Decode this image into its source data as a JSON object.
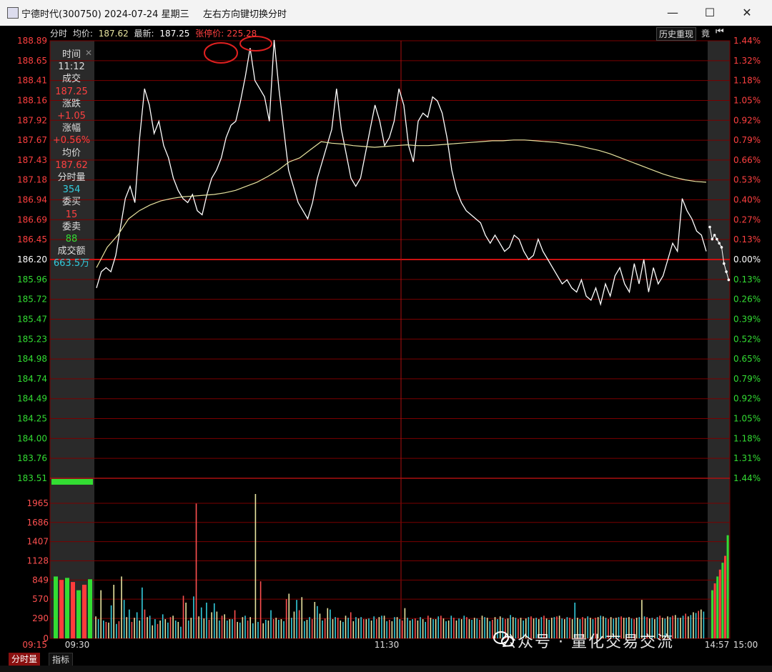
{
  "window": {
    "title": "宁德时代(300750) 2024-07-24 星期三",
    "hint": "左右方向键切换分时",
    "buttons": {
      "minimize": "—",
      "maximize": "☐",
      "close": "✕"
    }
  },
  "header": {
    "label_fenshi": "分时",
    "label_avg": "均价:",
    "avg_value": "187.62",
    "label_latest": "最新:",
    "latest_value": "187.25",
    "label_limit": "张停价:",
    "limit_value": "225.28",
    "history_replay": "历史重现",
    "auction_label": "竟"
  },
  "info_panel": {
    "time_label": "时间",
    "time_value": "11:12",
    "trade_label": "成交",
    "trade_value": "187.25",
    "change_label": "涨跌",
    "change_value": "+1.05",
    "pct_label": "涨幅",
    "pct_value": "+0.56%",
    "avg_label": "均价",
    "avg_value": "187.62",
    "vol_label": "分时量",
    "vol_value": "354",
    "bid_label": "委买",
    "bid_value": "15",
    "ask_label": "委卖",
    "ask_value": "88",
    "amount_label": "成交额",
    "amount_value": "663.5万"
  },
  "price_axis": [
    "188.89",
    "188.65",
    "188.41",
    "188.16",
    "187.92",
    "187.67",
    "187.43",
    "187.18",
    "186.94",
    "186.69",
    "186.45",
    "186.20",
    "185.96",
    "185.72",
    "185.47",
    "185.23",
    "184.98",
    "184.74",
    "184.49",
    "184.25",
    "184.00",
    "183.76",
    "183.51"
  ],
  "pct_axis": [
    "1.44%",
    "1.32%",
    "1.18%",
    "1.05%",
    "0.92%",
    "0.79%",
    "0.66%",
    "0.53%",
    "0.40%",
    "0.27%",
    "0.13%",
    "0.00%",
    "0.13%",
    "0.26%",
    "0.39%",
    "0.52%",
    "0.65%",
    "0.79%",
    "0.92%",
    "1.05%",
    "1.18%",
    "1.31%",
    "1.44%"
  ],
  "volume_axis": [
    "1965",
    "1686",
    "1407",
    "1128",
    "849",
    "570",
    "290",
    "0"
  ],
  "time_axis": [
    "09:15",
    "09:30",
    "11:30",
    "14:57",
    "15:00"
  ],
  "tabs": [
    "分时量",
    "指标"
  ],
  "watermark": "公众号 · 量化交易交流",
  "colors": {
    "up": "#ff3b3b",
    "down": "#33dd33",
    "price_line": "#ffffff",
    "avg_line": "#e8e4a0",
    "grid": "#7a0000",
    "axis_red": "#ff4040",
    "vol_label": "#ff4040",
    "cyan": "#33ccdd"
  },
  "chart_data": {
    "type": "line",
    "title": "",
    "series": [
      {
        "name": "",
        "values": [
          185.85,
          186.05,
          186.1,
          186.05,
          186.25,
          186.6,
          186.95,
          187.1,
          186.9,
          187.7,
          188.3,
          188.1,
          187.75,
          187.9,
          187.6,
          187.45,
          187.2,
          187.05,
          186.95,
          186.9,
          187.0,
          186.8,
          186.75,
          187.0,
          187.2,
          187.3,
          187.45,
          187.7,
          187.85,
          187.9,
          188.15,
          188.45,
          188.8,
          188.4,
          188.3,
          188.2,
          187.9,
          188.9,
          188.3,
          187.8,
          187.3,
          187.1,
          186.9,
          186.8,
          186.7,
          186.9,
          187.2,
          187.4,
          187.6,
          187.8,
          188.3,
          187.8,
          187.5,
          187.2,
          187.1,
          187.2,
          187.5,
          187.8,
          188.1,
          187.9,
          187.6,
          187.7,
          187.9,
          188.3,
          188.1,
          187.6,
          187.4,
          187.9,
          188.0,
          187.95,
          188.2,
          188.15,
          188.0,
          187.7,
          187.3,
          187.05,
          186.9,
          186.8,
          186.75,
          186.7,
          186.65,
          186.5,
          186.4,
          186.5,
          186.4,
          186.3,
          186.35,
          186.5,
          186.45,
          186.3,
          186.2,
          186.25,
          186.45,
          186.3,
          186.2,
          186.1,
          186.0,
          185.9,
          185.95,
          185.85,
          185.8,
          185.95,
          185.75,
          185.7,
          185.85,
          185.65,
          185.9,
          185.75,
          186.0,
          186.1,
          185.9,
          185.8,
          186.15,
          185.9,
          186.2,
          185.8,
          186.1,
          185.9,
          186.0,
          186.2,
          186.4,
          186.3,
          186.95,
          186.8,
          186.7,
          186.55,
          186.5,
          186.3
        ]
      },
      {
        "name": "",
        "values": [
          186.1,
          186.35,
          186.5,
          186.7,
          186.8,
          186.87,
          186.92,
          186.95,
          186.97,
          186.98,
          186.99,
          187.0,
          187.02,
          187.05,
          187.1,
          187.15,
          187.22,
          187.3,
          187.4,
          187.45,
          187.55,
          187.65,
          187.63,
          187.62,
          187.6,
          187.59,
          187.58,
          187.59,
          187.6,
          187.61,
          187.6,
          187.6,
          187.61,
          187.62,
          187.63,
          187.64,
          187.65,
          187.66,
          187.66,
          187.67,
          187.67,
          187.66,
          187.65,
          187.64,
          187.62,
          187.6,
          187.57,
          187.54,
          187.5,
          187.45,
          187.4,
          187.35,
          187.3,
          187.25,
          187.21,
          187.18,
          187.16,
          187.15
        ]
      }
    ],
    "x_range": [
      "09:30",
      "15:00"
    ],
    "ylim": [
      183.51,
      188.89
    ],
    "reference_price": 186.2,
    "volume": {
      "ylim": [
        0,
        2245
      ],
      "pre_auction": [
        900,
        850,
        880,
        820,
        700,
        780,
        860
      ],
      "values": [
        320,
        280,
        700,
        260,
        240,
        230,
        480,
        780,
        210,
        250,
        900,
        560,
        310,
        420,
        240,
        300,
        380,
        260,
        740,
        420,
        310,
        330,
        190,
        280,
        210,
        260,
        350,
        280,
        230,
        310,
        330,
        260,
        240,
        170,
        620,
        520,
        260,
        300,
        610,
        1960,
        320,
        450,
        290,
        520,
        270,
        380,
        510,
        390,
        260,
        330,
        350,
        260,
        280,
        280,
        410,
        240,
        230,
        310,
        330,
        260,
        310,
        220,
        2100,
        240,
        830,
        220,
        270,
        260,
        410,
        280,
        300,
        270,
        280,
        250,
        570,
        650,
        300,
        390,
        560,
        410,
        600,
        250,
        270,
        310,
        280,
        530,
        470,
        360,
        260,
        290,
        440,
        420,
        280,
        310,
        300,
        260,
        240,
        330,
        300,
        380,
        250,
        310,
        290,
        310,
        280,
        280,
        290,
        260,
        320,
        280,
        310,
        330,
        330,
        250,
        270,
        250,
        310,
        310,
        280,
        260,
        440,
        300,
        260,
        280,
        290,
        260,
        310,
        280,
        240,
        330,
        300,
        280,
        280,
        320,
        330,
        290,
        250,
        260,
        330,
        300,
        260,
        290,
        280,
        330,
        310,
        280,
        270,
        300,
        290,
        270,
        330,
        310,
        300,
        250,
        270,
        310,
        280,
        320,
        300,
        280,
        290,
        340,
        310,
        300,
        280,
        300,
        260,
        290,
        310,
        320,
        290,
        300,
        280,
        310,
        330,
        290,
        270,
        300,
        310,
        320,
        330,
        290,
        280,
        310,
        300,
        280,
        520,
        300,
        280,
        310,
        290,
        320,
        300,
        280,
        300,
        310,
        330,
        320,
        300,
        280,
        310,
        290,
        300,
        310,
        320,
        300,
        300,
        310,
        290,
        280,
        300,
        310,
        560,
        320,
        310,
        290,
        300,
        280,
        310,
        330,
        300,
        290,
        320,
        310,
        330,
        340,
        300,
        300,
        330,
        360,
        320,
        340,
        380,
        370,
        400,
        420,
        390
      ],
      "closing_auction": [
        700,
        800,
        900,
        1000,
        1100,
        1200,
        1500
      ]
    }
  }
}
